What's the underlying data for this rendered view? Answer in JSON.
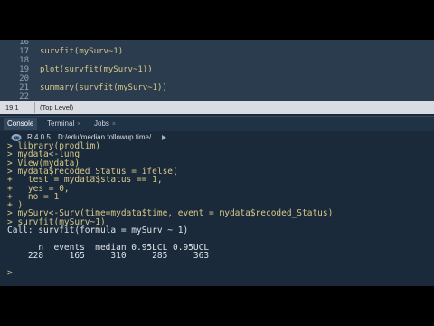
{
  "editor": {
    "lines": [
      {
        "num": "16",
        "code": ""
      },
      {
        "num": "17",
        "code": "survfit(mySurv~1)"
      },
      {
        "num": "18",
        "code": ""
      },
      {
        "num": "19",
        "code": "plot(survfit(mySurv~1))"
      },
      {
        "num": "20",
        "code": ""
      },
      {
        "num": "21",
        "code": "summary(survfit(mySurv~1))"
      },
      {
        "num": "22",
        "code": ""
      }
    ],
    "cursor_position": "19:1",
    "scope": "(Top Level)"
  },
  "tabs": [
    {
      "label": "Console",
      "active": true
    },
    {
      "label": "Terminal",
      "active": false
    },
    {
      "label": "Jobs",
      "active": false
    }
  ],
  "tab_close_glyph": "×",
  "console_header": {
    "r_version": "R 4.0.5",
    "path": "D:/edu/median followup time/"
  },
  "console": {
    "lines": [
      {
        "text": "> library(prodlim)",
        "kind": "cmd"
      },
      {
        "text": "> mydata<-lung",
        "kind": "cmd"
      },
      {
        "text": "> View(mydata)",
        "kind": "cmd"
      },
      {
        "text": "> mydata$recoded_Status = ifelse(",
        "kind": "cmd"
      },
      {
        "text": "+   test = mydata$status == 1,",
        "kind": "cmd"
      },
      {
        "text": "+   yes = 0,",
        "kind": "cmd"
      },
      {
        "text": "+   no = 1",
        "kind": "cmd"
      },
      {
        "text": "+ )",
        "kind": "cmd"
      },
      {
        "text": "> mySurv<-Surv(time=mydata$time, event = mydata$recoded_Status)",
        "kind": "cmd"
      },
      {
        "text": "> survfit(mySurv~1)",
        "kind": "cmd"
      },
      {
        "text": "Call: survfit(formula = mySurv ~ 1)",
        "kind": "out"
      },
      {
        "text": "",
        "kind": "out"
      },
      {
        "text": "      n  events  median 0.95LCL 0.95UCL",
        "kind": "out"
      },
      {
        "text": "    228     165     310     285     363",
        "kind": "out"
      },
      {
        "text": "",
        "kind": "out"
      },
      {
        "text": ">",
        "kind": "cmd"
      }
    ]
  },
  "colors": {
    "background": "#1b2a3a",
    "editor_bg": "#2b3c4e",
    "command_text": "#d7c88a",
    "output_text": "#dfe5ea"
  }
}
